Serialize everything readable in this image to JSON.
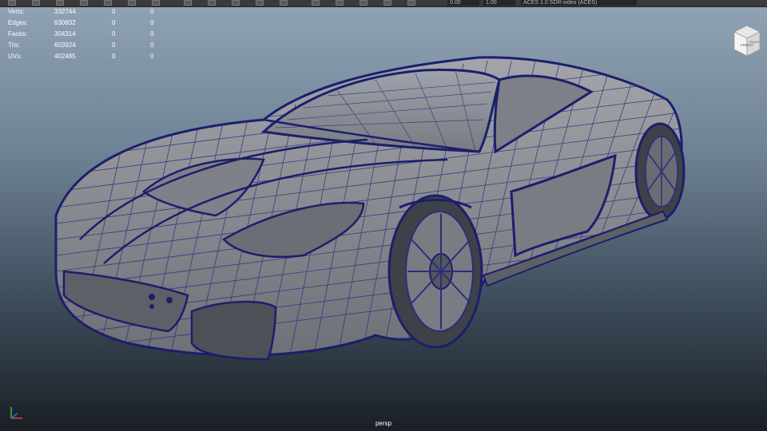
{
  "toolbar": {
    "field_a": "0.00",
    "field_b": "1.00",
    "colorspace": "ACES 1.0 SDR-video (ACES)"
  },
  "hud": {
    "rows": [
      {
        "label": "Verts:",
        "v1": "332744",
        "v2": "0",
        "v3": "0"
      },
      {
        "label": "Edges:",
        "v1": "630832",
        "v2": "0",
        "v3": "0"
      },
      {
        "label": "Faces:",
        "v1": "304314",
        "v2": "0",
        "v3": "0"
      },
      {
        "label": "Tris:",
        "v1": "603924",
        "v2": "0",
        "v3": "0"
      },
      {
        "label": "UVs:",
        "v1": "402485",
        "v2": "0",
        "v3": "0"
      }
    ]
  },
  "viewcube": {
    "front": "FRONT",
    "right": "RIGHT"
  },
  "camera": {
    "name": "persp"
  },
  "colors": {
    "wire": "#1b1f6b",
    "body": "#8a8c92",
    "bg_top": "#91a4b6",
    "bg_bottom": "#1a1f25"
  }
}
